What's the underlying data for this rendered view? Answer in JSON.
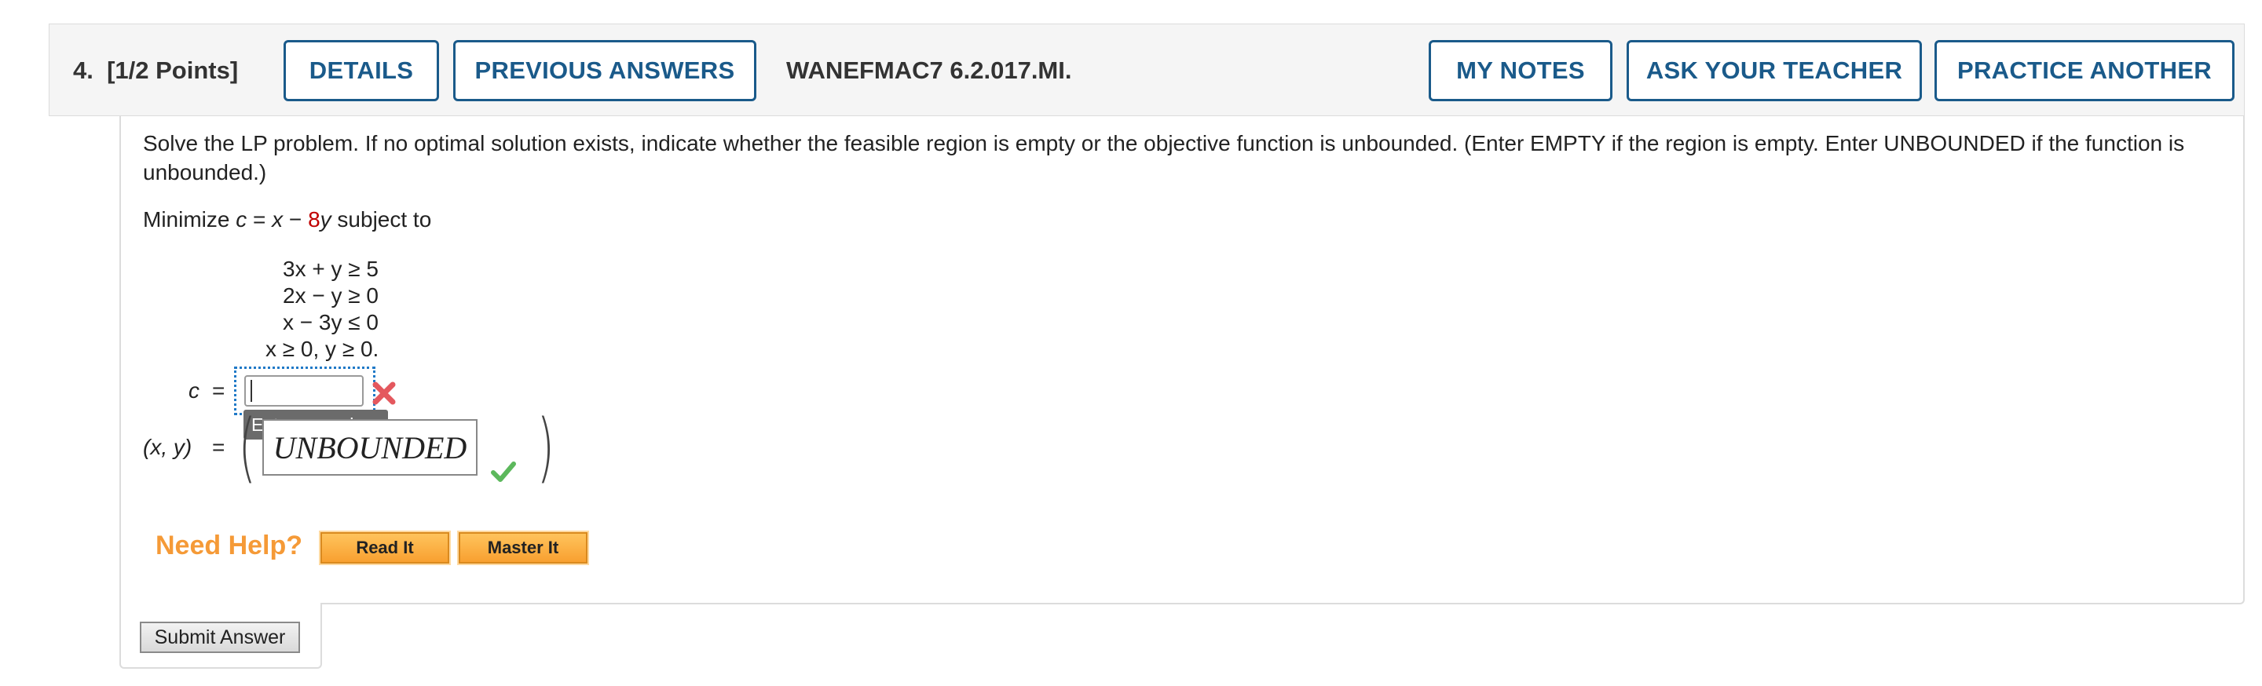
{
  "header": {
    "question_number": "4.",
    "points": "[1/2 Points]",
    "details_label": "DETAILS",
    "previous_answers_label": "PREVIOUS ANSWERS",
    "assignment_id": "WANEFMAC7 6.2.017.MI.",
    "my_notes_label": "MY NOTES",
    "ask_teacher_label": "ASK YOUR TEACHER",
    "practice_another_label": "PRACTICE ANOTHER"
  },
  "problem": {
    "instructions": "Solve the LP problem. If no optimal solution exists, indicate whether the feasible region is empty or the objective function is unbounded. (Enter EMPTY if the region is empty. Enter UNBOUNDED if the function is unbounded.)",
    "objective_prefix": "Minimize ",
    "objective_var_c": "c",
    "objective_eq": " = ",
    "objective_x": "x",
    "objective_minus": " − ",
    "objective_coef": "8",
    "objective_y": "y",
    "objective_suffix": " subject to",
    "constraints": [
      "3x + y ≥ 5",
      "2x − y ≥ 0",
      "x − 3y ≤ 0",
      "x ≥ 0, y ≥ 0."
    ]
  },
  "answers": {
    "c_label": "c",
    "c_equals": "=",
    "c_value": "",
    "c_tooltip": "Enter a number.",
    "xy_label": "(x, y)",
    "xy_equals": "=",
    "xy_value": "UNBOUNDED",
    "open_paren": "(",
    "close_paren": ")"
  },
  "help": {
    "need_help_label": "Need Help?",
    "read_it_label": "Read It",
    "master_it_label": "Master It"
  },
  "submit": {
    "label": "Submit Answer"
  },
  "colors": {
    "accent_blue": "#1a5a8a",
    "coefficient_red": "#c00000",
    "incorrect_red": "#e4585e",
    "correct_green": "#5cb85c",
    "help_orange": "#f59a37"
  }
}
